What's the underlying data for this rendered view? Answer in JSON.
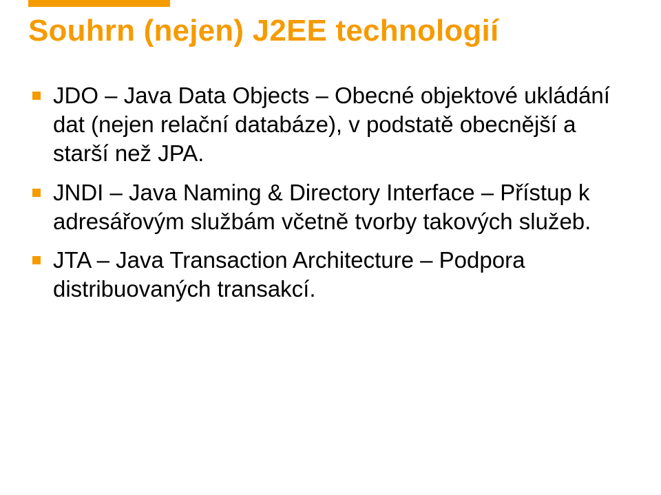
{
  "accent_color": "#f59b00",
  "title": "Souhrn (nejen) J2EE technologií",
  "bullets": [
    "JDO – Java Data Objects – Obecné objektové ukládání dat (nejen relační databáze), v podstatě obecnější a starší než JPA.",
    "JNDI – Java Naming & Directory Interface – Přístup k adresářovým službám včetně tvorby takových služeb.",
    "JTA – Java Transaction Architecture – Podpora distribuovaných transakcí."
  ]
}
